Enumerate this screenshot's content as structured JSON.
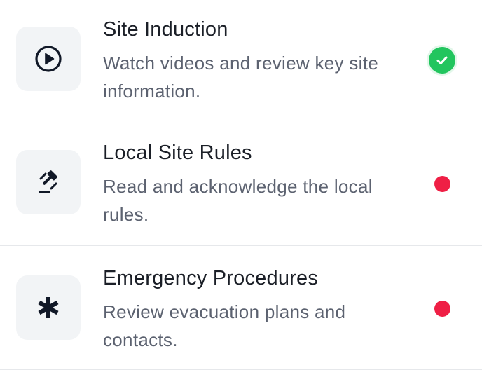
{
  "colors": {
    "complete": "#22c55e",
    "pending": "#ef1f45",
    "title": "#1b1f27",
    "description": "#5c6270",
    "icon_bg": "#f2f4f6"
  },
  "items": [
    {
      "title": "Site Induction",
      "description": "Watch videos and review key site information.",
      "icon": "play-circle-icon",
      "status": "complete"
    },
    {
      "title": "Local Site Rules",
      "description": "Read and acknowledge the local rules.",
      "icon": "gavel-icon",
      "status": "pending"
    },
    {
      "title": "Emergency Procedures",
      "description": "Review evacuation plans and contacts.",
      "icon": "asterisk-icon",
      "status": "pending"
    }
  ]
}
